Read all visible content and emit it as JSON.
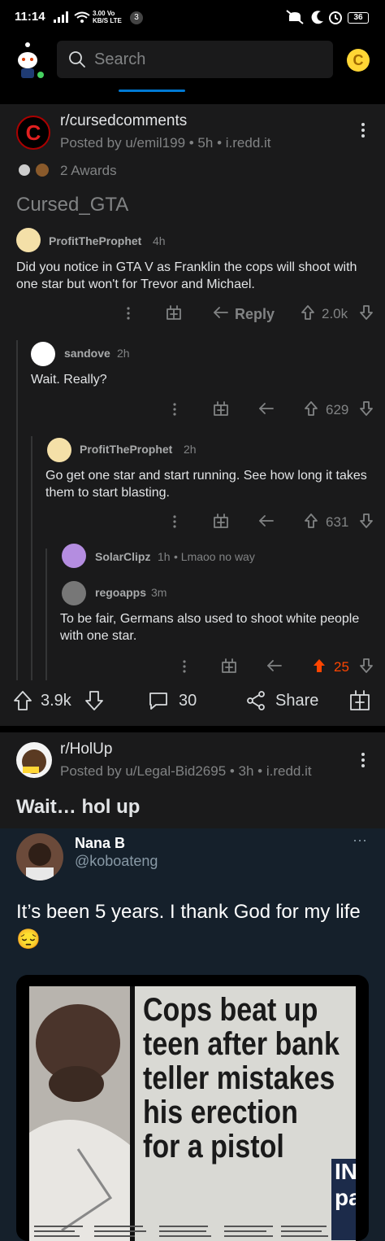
{
  "status": {
    "time": "11:14",
    "speed_value": "3.00",
    "speed_unit": "KB/S",
    "net1": "Vo",
    "net2": "LTE",
    "sim_badge": "3",
    "battery": "36"
  },
  "search": {
    "placeholder": "Search"
  },
  "post1": {
    "subreddit": "r/cursedcomments",
    "meta": "Posted by u/emil199 • 5h • i.redd.it",
    "awards": "2 Awards",
    "title": "Cursed_GTA",
    "icon_text": "C",
    "comments": [
      {
        "author": "ProfitTheProphet",
        "age": "4h",
        "text": "Did you notice in GTA V as Franklin the cops will shoot with one star but won't for Trevor and Michael.",
        "reply_label": "Reply",
        "score": "2.0k"
      },
      {
        "author": "sandove",
        "age": "2h",
        "text": "Wait. Really?",
        "score": "629"
      },
      {
        "author": "ProfitTheProphet",
        "age": "2h",
        "text": "Go get one star and start running. See how long it takes them to start blasting.",
        "score": "631"
      },
      {
        "author": "SolarClipz",
        "age": "1h",
        "collapsed_text": "• Lmaoo no way"
      },
      {
        "author": "regoapps",
        "age": "3m",
        "text": "To be fair, Germans also used to shoot white people with one star.",
        "score": "25"
      }
    ],
    "footer": {
      "score": "3.9k",
      "comments": "30",
      "share": "Share"
    }
  },
  "post2": {
    "subreddit": "r/HolUp",
    "meta": "Posted by u/Legal-Bid2695 • 3h • i.redd.it",
    "title": "Wait… hol up",
    "tweet": {
      "name": "Nana B",
      "handle": "@koboateng",
      "text": "It’s been 5 years. I thank God for my life 😔",
      "more": "···"
    },
    "newspaper": {
      "headline_lines": [
        "Cops beat up",
        "teen after bank",
        "teller mistakes",
        "his erection",
        "for a pistol"
      ],
      "side_text": "IN pa"
    }
  },
  "colors": {
    "accent": "#0079d3",
    "upvote": "#ff4500",
    "coin": "#ffd635"
  }
}
